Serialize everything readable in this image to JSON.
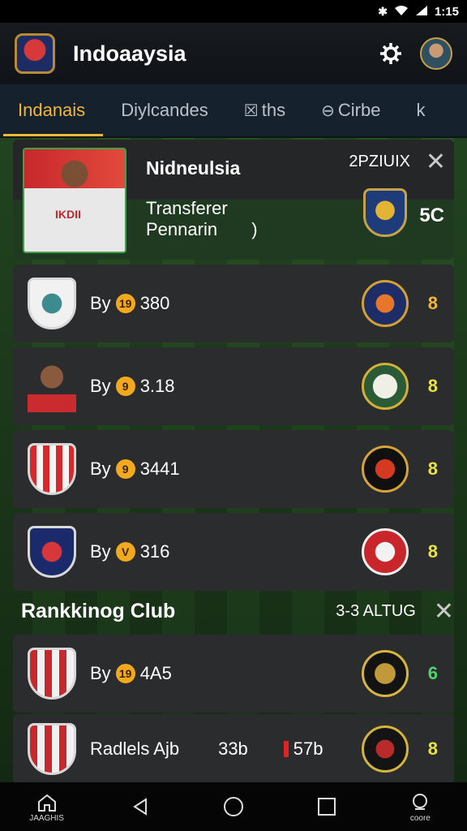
{
  "status_bar": {
    "time": "1:15"
  },
  "header": {
    "title": "Indoaaysia"
  },
  "tabs": [
    {
      "label": "Indanais",
      "icon": ""
    },
    {
      "label": "Diylcandes",
      "icon": ""
    },
    {
      "label": "ths",
      "icon": "calendar-icon"
    },
    {
      "label": "Cirbe",
      "icon": "back-circle-icon"
    },
    {
      "label": "k",
      "icon": ""
    }
  ],
  "featured": {
    "name": "Nidneulsia",
    "code": "2PZIUIX",
    "type": "Transferer",
    "player": "Pennarin",
    "player_mark": ")",
    "score": "5C",
    "shirt_text": "IKDII"
  },
  "rows": [
    {
      "label": "By",
      "coin": "19",
      "value": "380",
      "score": "8"
    },
    {
      "label": "By",
      "coin": "9",
      "value": "3.18",
      "score": "8"
    },
    {
      "label": "By",
      "coin": "9",
      "value": "3441",
      "score": "8"
    },
    {
      "label": "By",
      "coin": "V",
      "value": "316",
      "score": "8"
    }
  ],
  "section": {
    "title": "Rankkinog Club",
    "code": "3-3 ALTUG"
  },
  "ranking_rows": [
    {
      "label": "By",
      "coin": "19",
      "value": "4A5",
      "score": "6"
    },
    {
      "label": "Radlels Ajb",
      "value": "33b",
      "value2": "57b",
      "score": "8"
    }
  ],
  "nav": {
    "home_label": "JAAGHIS",
    "menu_label": "coore"
  },
  "colors": {
    "accent": "#f2b63a",
    "tabs_bg": "#15212d",
    "card_bg": "#2b2c2d",
    "score_green": "#4fd16b"
  }
}
